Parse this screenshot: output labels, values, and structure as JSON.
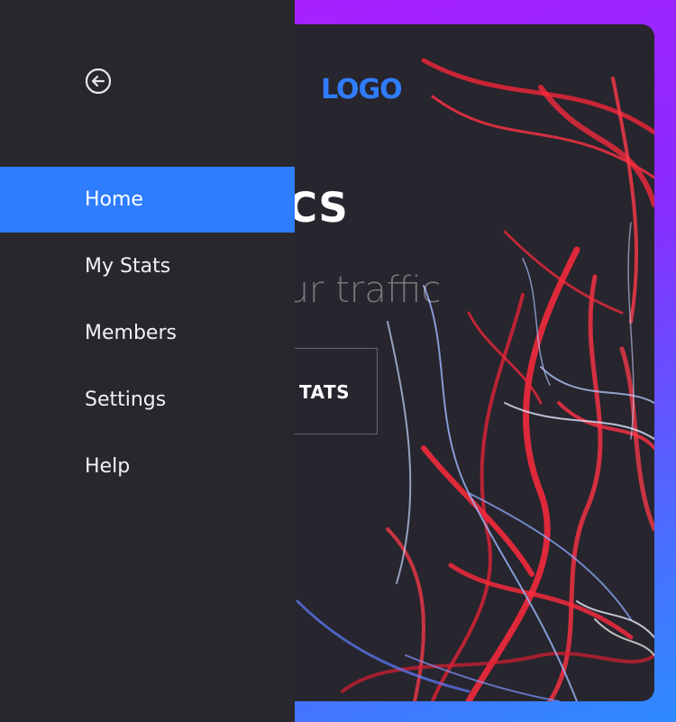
{
  "sidebar": {
    "back_icon": "arrow-left-circle-icon",
    "items": [
      {
        "label": "Home",
        "active": true
      },
      {
        "label": "My Stats",
        "active": false
      },
      {
        "label": "Members",
        "active": false
      },
      {
        "label": "Settings",
        "active": false
      },
      {
        "label": "Help",
        "active": false
      }
    ]
  },
  "main": {
    "logo": "LOGO",
    "hero_title": "ALYTICS",
    "hero_subtitle": "se of your traffic",
    "hero_button": "TATS"
  },
  "colors": {
    "accent": "#2f7dff",
    "sidebar_bg": "#29272e",
    "frame_gradient_start": "#b21dff",
    "frame_gradient_end": "#2e8bff",
    "streak_red": "#ff2a3d",
    "streak_blue": "#8fb4ff"
  }
}
